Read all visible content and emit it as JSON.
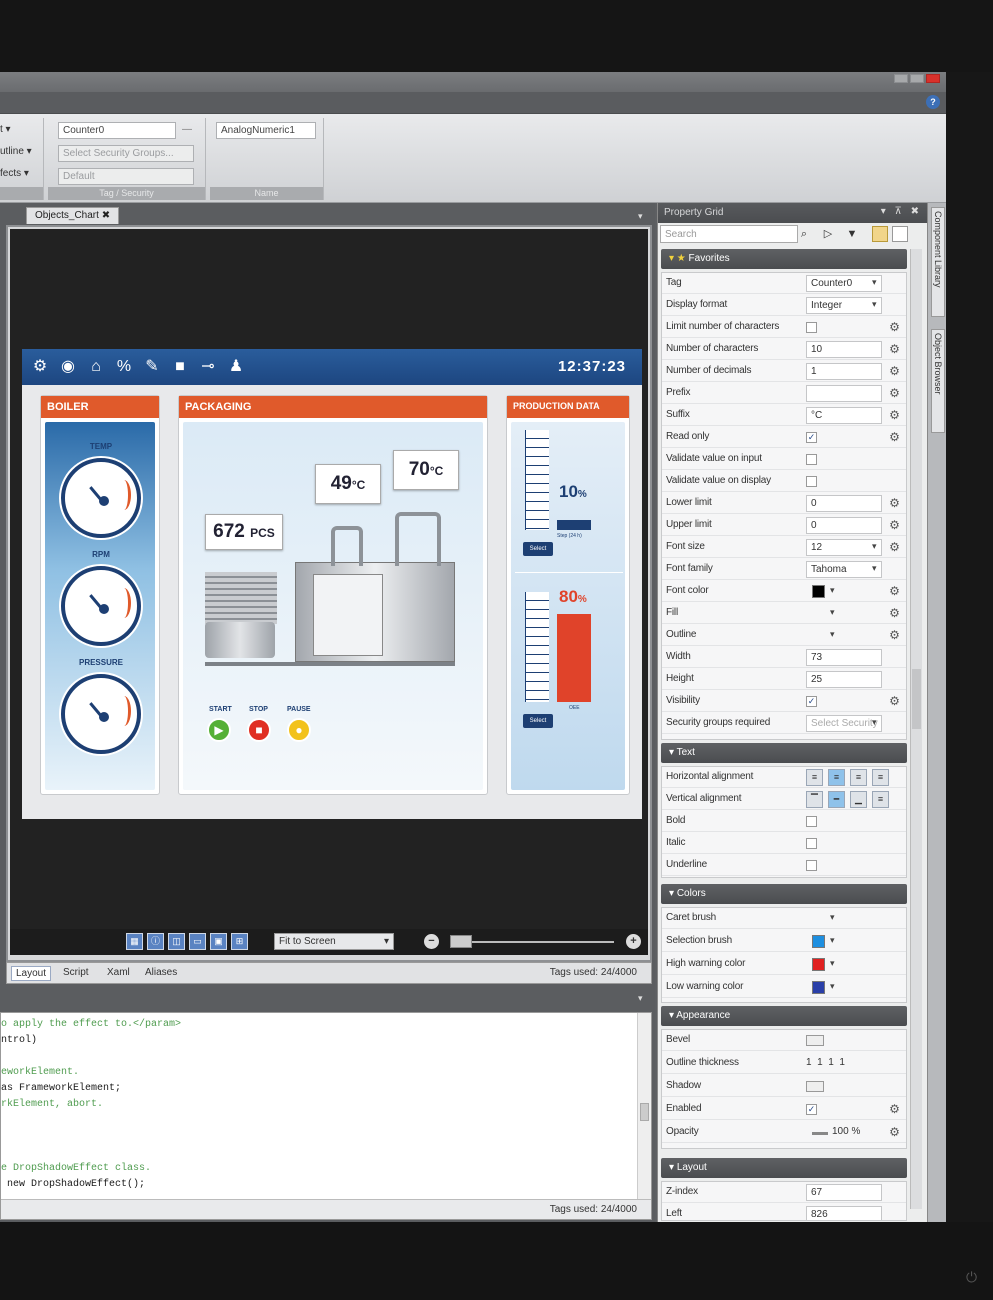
{
  "ribbon": {
    "left_items": [
      "t ▾",
      "utline ▾",
      "fects ▾"
    ],
    "tag_field": "Counter0",
    "security_field": "Select Security Groups...",
    "default_field": "Default",
    "tag_security_label": "Tag / Security",
    "name_field": "AnalogNumeric1",
    "name_label": "Name"
  },
  "document": {
    "tab_label": "Objects_Chart",
    "hmi": {
      "clock": "12:37:23",
      "boiler": {
        "title": "BOILER",
        "gauges": [
          "TEMP",
          "RPM",
          "PRESSURE"
        ]
      },
      "packaging": {
        "title": "PACKAGING",
        "count_value": "672",
        "count_unit": "PCS",
        "temp1_value": "49",
        "temp1_unit": "°C",
        "temp2_value": "70",
        "temp2_unit": "°C",
        "controls": [
          "START",
          "STOP",
          "PAUSE"
        ]
      },
      "production": {
        "title": "PRODUCTION DATA",
        "level1_value": "10",
        "level1_unit": "%",
        "level1_caption": "Step (24 h)",
        "level1_fraction": 0.1,
        "level2_value": "80",
        "level2_unit": "%",
        "level2_caption": "OEE",
        "level2_fraction": 0.8,
        "select_label": "Select"
      }
    },
    "zoom_select": "Fit to Screen",
    "view_tabs": [
      "Layout",
      "Script",
      "Xaml",
      "Aliases"
    ],
    "tags_used": "Tags used: 24/4000"
  },
  "code": {
    "lines": [
      {
        "text": "o apply the effect to.</param>",
        "style": "green"
      },
      {
        "text": "ntrol)",
        "style": "dark"
      },
      {
        "text": "",
        "style": "dark"
      },
      {
        "text": "eworkElement.",
        "style": "green"
      },
      {
        "text": "as FrameworkElement;",
        "style": "dark"
      },
      {
        "text": "rkElement, abort.",
        "style": "green"
      },
      {
        "text": "",
        "style": "dark"
      },
      {
        "text": "",
        "style": "dark"
      },
      {
        "text": "",
        "style": "dark"
      },
      {
        "text": "e DropShadowEffect class.",
        "style": "green"
      },
      {
        "text": " new DropShadowEffect();",
        "style": "dark"
      }
    ],
    "tags_used": "Tags used: 24/4000"
  },
  "property_grid": {
    "title": "Property Grid",
    "search_placeholder": "Search",
    "sections": {
      "favorites": "Favorites",
      "text": "Text",
      "colors": "Colors",
      "appearance": "Appearance",
      "layout": "Layout"
    },
    "favorites": [
      {
        "label": "Tag",
        "value": "Counter0",
        "kind": "select"
      },
      {
        "label": "Display format",
        "value": "Integer",
        "kind": "select"
      },
      {
        "label": "Limit number of characters",
        "value": "",
        "kind": "check",
        "checked": false
      },
      {
        "label": "Number of characters",
        "value": "10",
        "kind": "input"
      },
      {
        "label": "Number of decimals",
        "value": "1",
        "kind": "input"
      },
      {
        "label": "Prefix",
        "value": "",
        "kind": "input"
      },
      {
        "label": "Suffix",
        "value": "°C",
        "kind": "input"
      },
      {
        "label": "Read only",
        "value": "",
        "kind": "check",
        "checked": true
      },
      {
        "label": "Validate value on input",
        "value": "",
        "kind": "check",
        "checked": false
      },
      {
        "label": "Validate value on display",
        "value": "",
        "kind": "check",
        "checked": false
      },
      {
        "label": "Lower limit",
        "value": "0",
        "kind": "input"
      },
      {
        "label": "Upper limit",
        "value": "0",
        "kind": "input"
      },
      {
        "label": "Font size",
        "value": "12",
        "kind": "select"
      },
      {
        "label": "Font family",
        "value": "Tahoma",
        "kind": "select"
      },
      {
        "label": "Font color",
        "value": "",
        "kind": "color",
        "color": "#000000"
      },
      {
        "label": "Fill",
        "value": "",
        "kind": "color",
        "color": ""
      },
      {
        "label": "Outline",
        "value": "",
        "kind": "color",
        "color": ""
      },
      {
        "label": "Width",
        "value": "73",
        "kind": "input"
      },
      {
        "label": "Height",
        "value": "25",
        "kind": "input"
      },
      {
        "label": "Visibility",
        "value": "",
        "kind": "check",
        "checked": true
      },
      {
        "label": "Security groups required",
        "value": "Select Security",
        "kind": "select"
      }
    ],
    "text": [
      {
        "label": "Horizontal alignment"
      },
      {
        "label": "Vertical alignment"
      },
      {
        "label": "Bold"
      },
      {
        "label": "Italic"
      },
      {
        "label": "Underline"
      }
    ],
    "colors": [
      {
        "label": "Caret brush",
        "color": ""
      },
      {
        "label": "Selection brush",
        "color": "#1e8fe0"
      },
      {
        "label": "High warning color",
        "color": "#e02020"
      },
      {
        "label": "Low warning color",
        "color": "#2a3fa8"
      }
    ],
    "appearance": [
      {
        "label": "Bevel",
        "value": ""
      },
      {
        "label": "Outline thickness",
        "value": "1  1  1  1"
      },
      {
        "label": "Shadow",
        "value": ""
      },
      {
        "label": "Enabled",
        "value": ""
      },
      {
        "label": "Opacity",
        "value": "100 %"
      }
    ],
    "layout": [
      {
        "label": "Z-index",
        "value": "67"
      },
      {
        "label": "Left",
        "value": "826"
      }
    ]
  },
  "side_tabs": [
    "Component Library",
    "Object Browser"
  ]
}
